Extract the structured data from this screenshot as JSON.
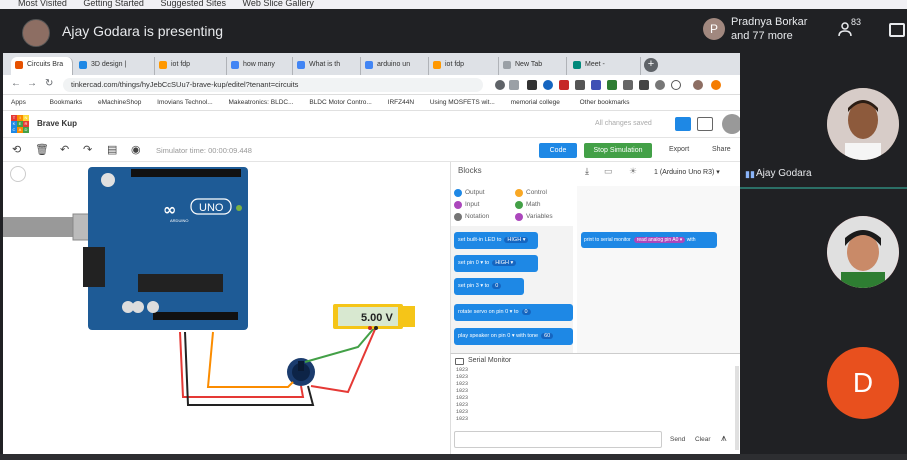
{
  "firefox_bookmarks": [
    "Most Visited",
    "Getting Started",
    "Suggested Sites",
    "Web Slice Gallery"
  ],
  "meet": {
    "presenting_label": "Ajay Godara is presenting",
    "participant_initial": "P",
    "participant_name": "Pradnya Borkar",
    "participant_more": "and 77 more",
    "people_count": "83"
  },
  "browser": {
    "tabs": [
      {
        "label": "Circuits Bra",
        "color": "#e65100"
      },
      {
        "label": "3D design |",
        "color": "#1e88e5"
      },
      {
        "label": "iot fdp",
        "color": "#ff9800"
      },
      {
        "label": "how many",
        "color": "#4285f4"
      },
      {
        "label": "What is th",
        "color": "#4285f4"
      },
      {
        "label": "arduino un",
        "color": "#4285f4"
      },
      {
        "label": "iot fdp",
        "color": "#ff9800"
      },
      {
        "label": "New Tab",
        "color": "#9aa0a6"
      },
      {
        "label": "Meet -",
        "color": "#00897b"
      }
    ],
    "url": "tinkercad.com/things/hyJebCcSUu7-brave-kup/editel?tenant=circuits",
    "bookmarks": [
      "Apps",
      "Bookmarks",
      "eMachineShop",
      "Imovians Technol...",
      "Makeatronics: BLDC...",
      "BLDC Motor Contro...",
      "IRFZ44N",
      "Using MOSFETS wit...",
      "memorial college",
      "Other bookmarks"
    ]
  },
  "tinkercad": {
    "logo_letters": [
      "T",
      "I",
      "N",
      "K",
      "E",
      "R",
      "C",
      "A",
      "D"
    ],
    "project_name": "Brave Kup",
    "saved_status": "All changes saved",
    "simulator_time": "Simulator time: 00:00:09.448",
    "code_label": "Code",
    "stop_label": "Stop Simulation",
    "export_label": "Export",
    "share_label": "Share",
    "multimeter_value": "5.00 V",
    "arduino_label": "UNO",
    "arduino_brand": "ARDUINO"
  },
  "blocks": {
    "title": "Blocks",
    "device": "1 (Arduino Uno R3)",
    "categories": [
      {
        "label": "Output",
        "color": "#1e88e5"
      },
      {
        "label": "Control",
        "color": "#f9a825"
      },
      {
        "label": "Input",
        "color": "#ab47bc"
      },
      {
        "label": "Math",
        "color": "#43a047"
      },
      {
        "label": "Notation",
        "color": "#757575"
      },
      {
        "label": "Variables",
        "color": "#ab47bc"
      }
    ],
    "palette": [
      {
        "text": "set built-in LED to",
        "arg": "HIGH ▾"
      },
      {
        "text": "set pin  0 ▾  to",
        "arg": "HIGH ▾"
      },
      {
        "text": "set pin  3 ▾  to",
        "arg": "0"
      },
      {
        "text": "rotate servo on pin  0 ▾  to",
        "arg": "0"
      },
      {
        "text": "play speaker on pin  0 ▾  with tone",
        "arg": "60"
      }
    ],
    "workspace_block": {
      "text": "print to serial monitor",
      "arg": "read analog pin  A0 ▾",
      "suffix": "with"
    }
  },
  "serial": {
    "title": "Serial Monitor",
    "lines": [
      "1023",
      "1023",
      "1023",
      "1023",
      "1023",
      "1023",
      "1023",
      "1023"
    ],
    "send_label": "Send",
    "clear_label": "Clear"
  },
  "side": {
    "speaker_name": "Ajay Godara",
    "d_initial": "D"
  }
}
